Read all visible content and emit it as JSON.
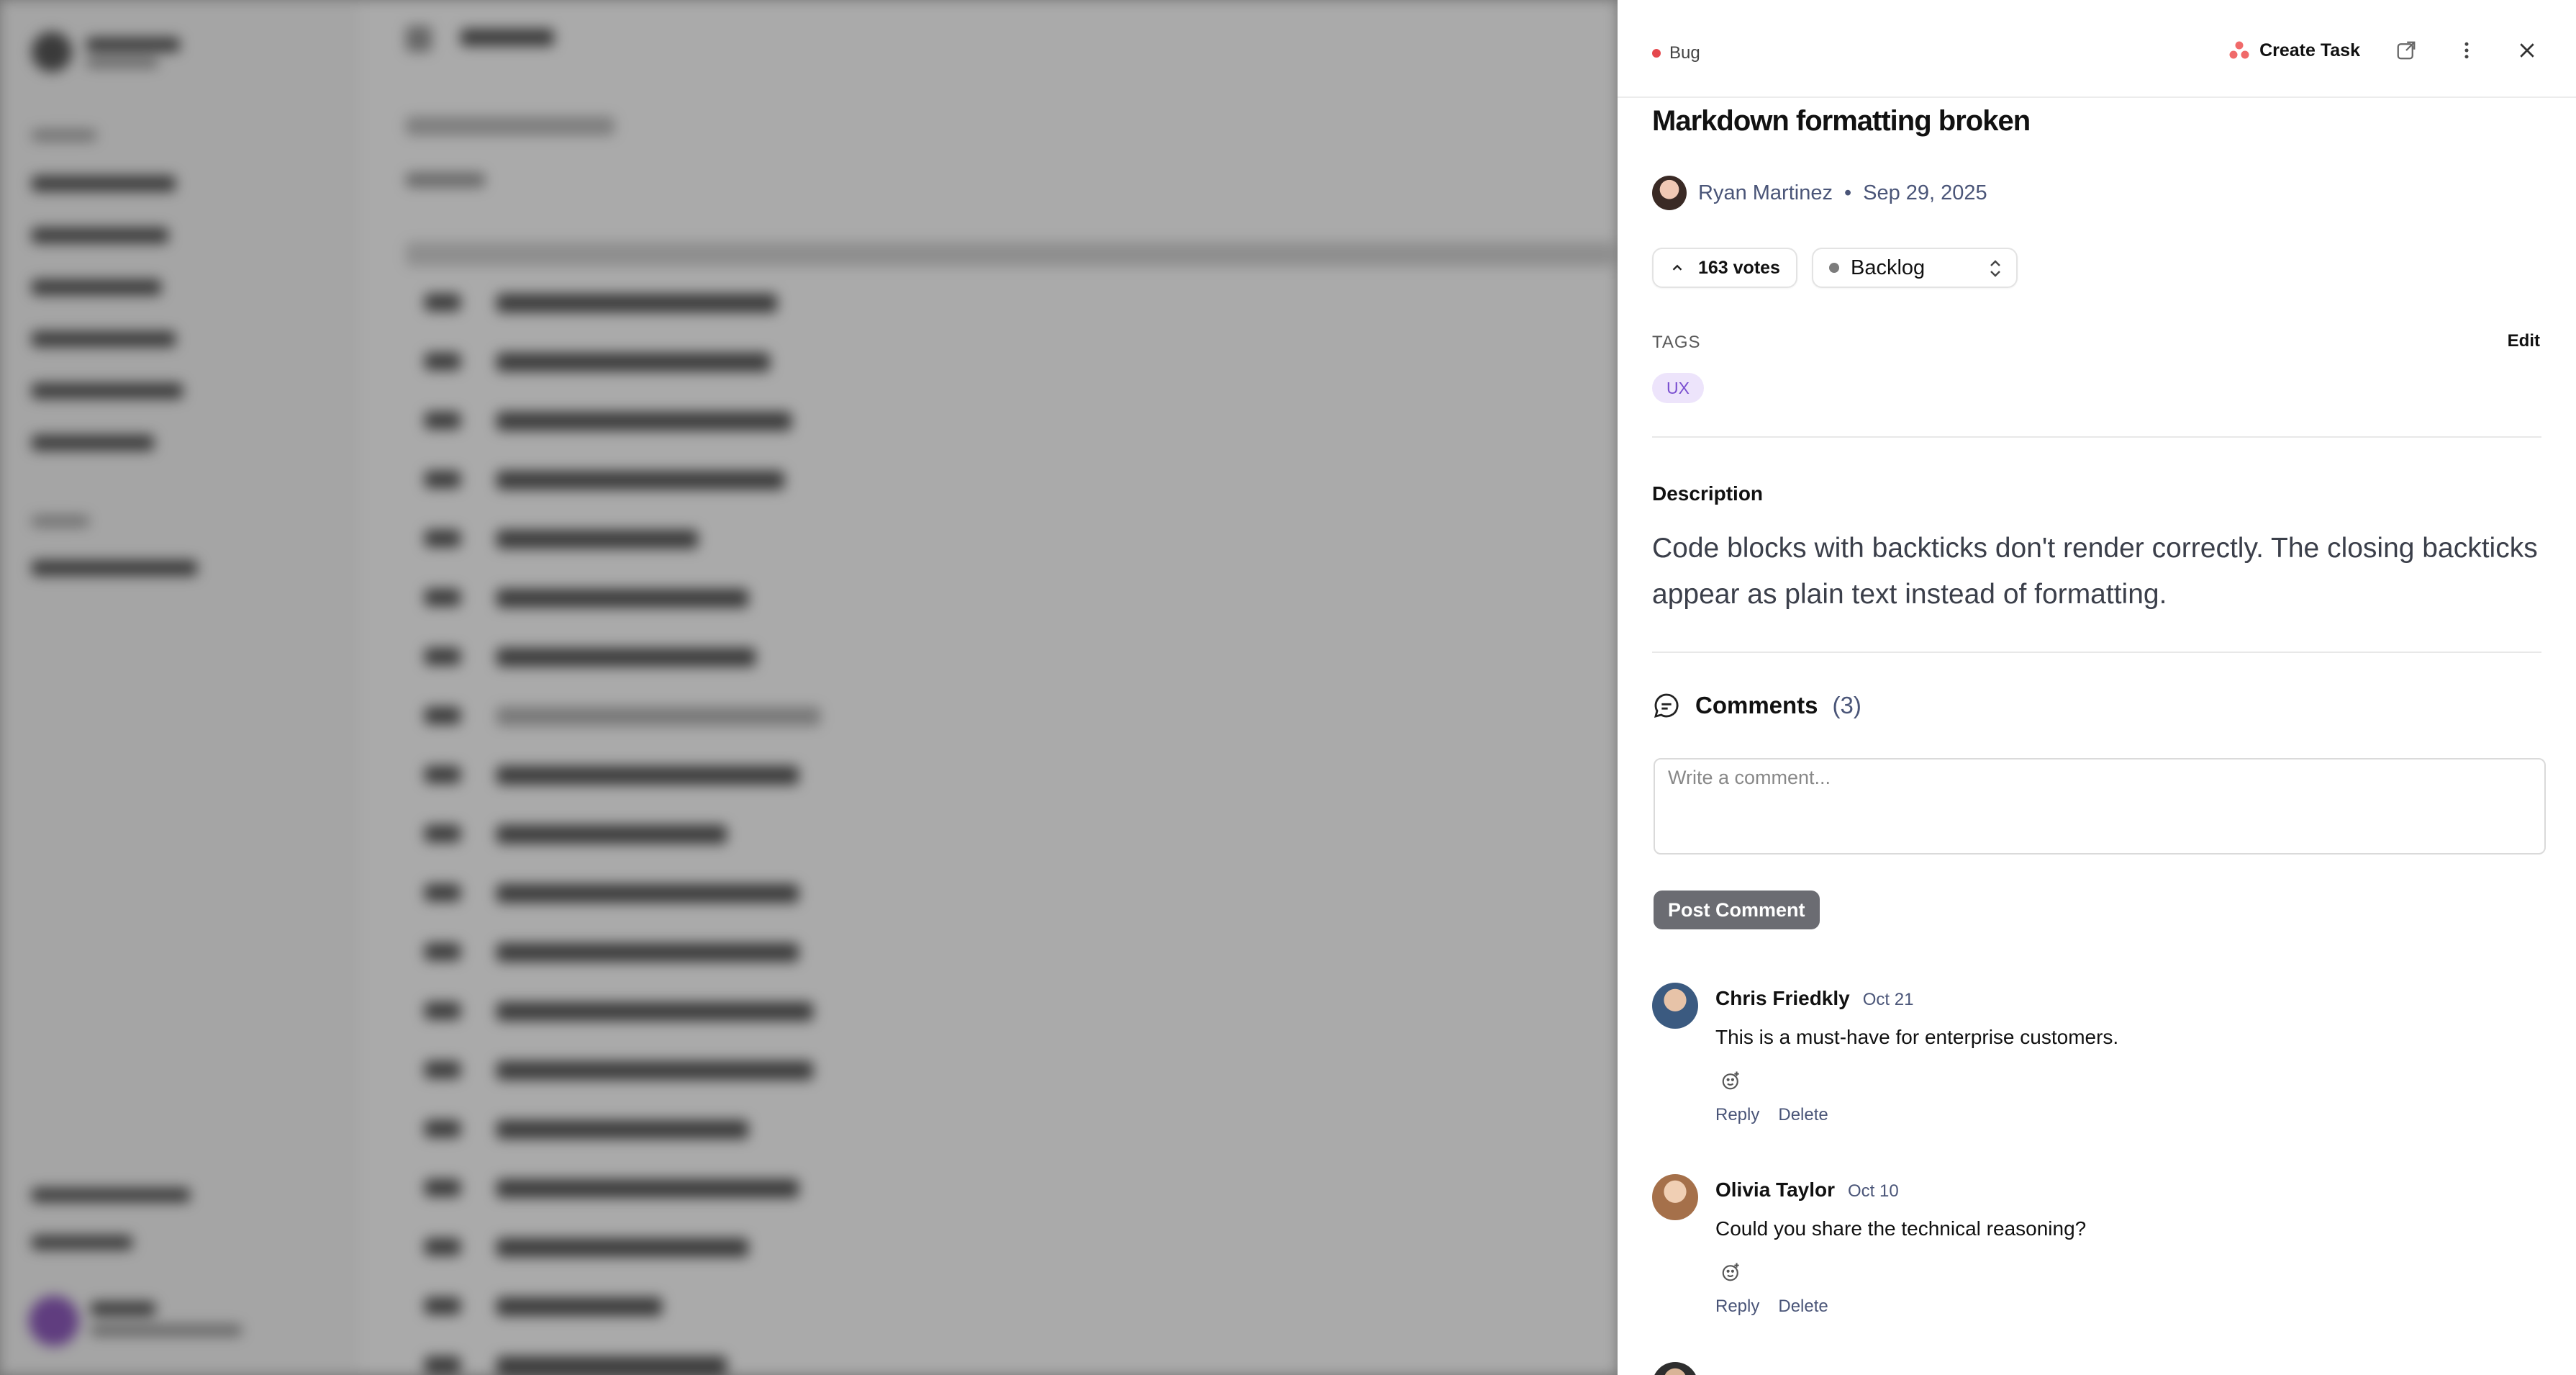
{
  "drawer": {
    "type_label": "Bug",
    "create_task_label": "Create Task",
    "title": "Markdown formatting broken",
    "author": "Ryan Martinez",
    "separator": "•",
    "date": "Sep 29, 2025",
    "votes_label": "163 votes",
    "status": "Backlog",
    "tags_label": "TAGS",
    "tags_edit_label": "Edit",
    "tags": [
      "UX"
    ],
    "description_label": "Description",
    "description": "Code blocks with backticks don't render correctly. The closing backticks appear as plain text instead of formatting.",
    "comments_label": "Comments",
    "comments_count": "(3)",
    "comment_placeholder": "Write a comment...",
    "post_button_label": "Post Comment",
    "comments": [
      {
        "author": "Chris Friedkly",
        "date": "Oct 21",
        "text": "This is a must-have for enterprise customers.",
        "reply_label": "Reply",
        "delete_label": "Delete"
      },
      {
        "author": "Olivia Taylor",
        "date": "Oct 10",
        "text": "Could you share the technical reasoning?",
        "reply_label": "Reply",
        "delete_label": "Delete"
      }
    ],
    "colors": {
      "bug_dot": "#e5484d",
      "tag_bg": "#ede4fb",
      "tag_text": "#7a4fd0",
      "post_button_bg": "#6b6c72",
      "muted_text": "#4a5578"
    },
    "icons": [
      "bug-dot-icon",
      "create-task-icon",
      "open-external-icon",
      "more-vertical-icon",
      "close-icon",
      "chevron-up-icon",
      "status-dot-icon",
      "chevron-updown-icon",
      "comment-icon",
      "add-reaction-icon"
    ]
  }
}
